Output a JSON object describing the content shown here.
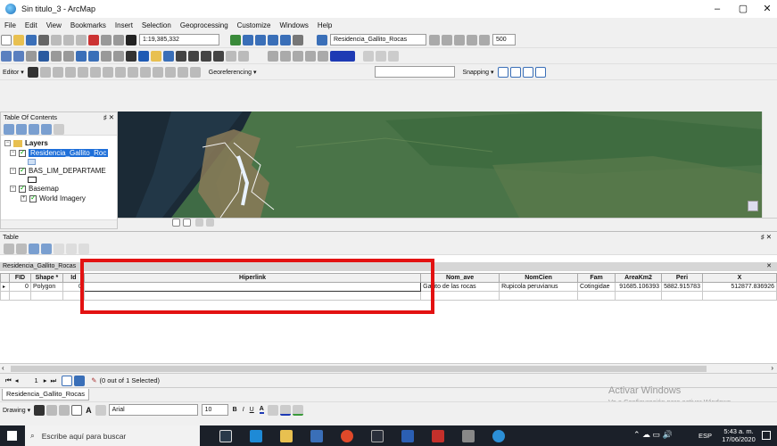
{
  "window": {
    "title": "Sin titulo_3 - ArcMap",
    "minimize": "–",
    "maximize": "▢",
    "close": "✕"
  },
  "menu": [
    "File",
    "Edit",
    "View",
    "Bookmarks",
    "Insert",
    "Selection",
    "Geoprocessing",
    "Customize",
    "Windows",
    "Help"
  ],
  "toolbar": {
    "scale": "1:19,385,332",
    "layer_select": "Residencia_Gallito_Rocas",
    "size_value": "500",
    "editor_label": "Editor ▾",
    "georef_label": "Georeferencing ▾",
    "snapping_label": "Snapping ▾"
  },
  "toc": {
    "title": "Table Of Contents",
    "pin": "♯ ✕",
    "root": "Layers",
    "layers": [
      {
        "name": "Residencia_Gallito_Roc",
        "checked": true,
        "selected": true
      },
      {
        "name": "BAS_LIM_DEPARTAME",
        "checked": true,
        "selected": false
      },
      {
        "name": "Basemap",
        "checked": true,
        "selected": false
      }
    ],
    "sublayer": "World Imagery"
  },
  "table": {
    "window_title": "Table",
    "close": "♯ ✕",
    "layer_tab": "Residencia_Gallito_Rocas",
    "columns": [
      "FID",
      "Shape *",
      "Id",
      "Hiperlink",
      "Nom_ave",
      "NomCien",
      "Fam",
      "AreaKm2",
      "Peri",
      "X"
    ],
    "row": [
      "0",
      "Polygon",
      "0",
      "",
      "Gallito de las rocas",
      "Rupicola peruvianus",
      "Cotingidae",
      "91685.106393",
      "5882.915783",
      "512877.836926"
    ],
    "nav_position": "1",
    "selection_status": "(0 out of 1 Selected)",
    "bottom_tab": "Residencia_Gallito_Rocas"
  },
  "drawing": {
    "label": "Drawing ▾",
    "font": "Arial",
    "size": "10"
  },
  "watermark": {
    "title": "Activar Windows",
    "subtitle": "Ve a Configuración para activar Windows."
  },
  "taskbar": {
    "search_placeholder": "Escribe aquí para buscar",
    "time": "5:43 a. m.",
    "date": "17/06/2020",
    "lang": "ESP"
  }
}
